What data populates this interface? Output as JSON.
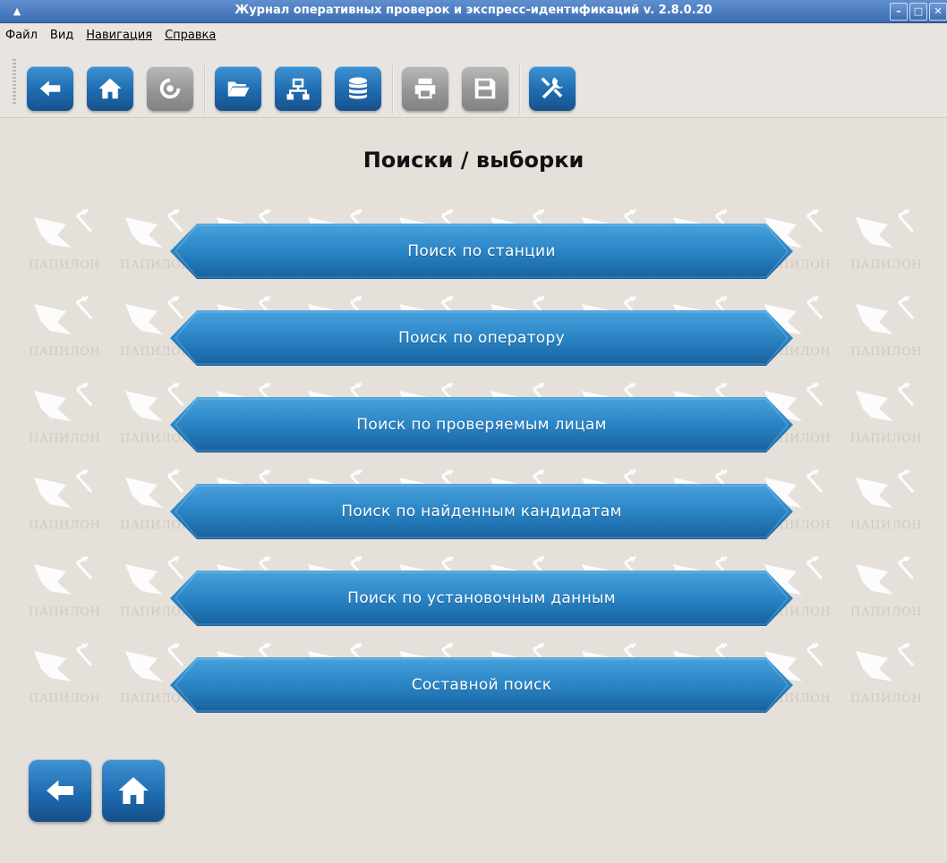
{
  "window": {
    "title": "Журнал оперативных проверок и экспресс-идентификаций v. 2.8.0.20"
  },
  "menu": [
    {
      "label": "Файл"
    },
    {
      "label": "Вид"
    },
    {
      "label": "Навигация"
    },
    {
      "label": "Справка"
    }
  ],
  "toolbar": {
    "buttons": [
      {
        "icon": "back-arrow-icon",
        "enabled": true
      },
      {
        "icon": "home-icon",
        "enabled": true
      },
      {
        "icon": "refresh-icon",
        "enabled": false
      },
      {
        "icon": "folder-open-icon",
        "enabled": true
      },
      {
        "icon": "network-icon",
        "enabled": true
      },
      {
        "icon": "database-icon",
        "enabled": true
      },
      {
        "icon": "print-icon",
        "enabled": false
      },
      {
        "icon": "save-icon",
        "enabled": false
      },
      {
        "icon": "tools-icon",
        "enabled": true
      }
    ]
  },
  "page": {
    "title": "Поиски / выборки",
    "watermark_text": "ПАПИЛОН"
  },
  "search_buttons": [
    {
      "label": "Поиск по станции"
    },
    {
      "label": "Поиск по оператору"
    },
    {
      "label": "Поиск по проверяемым лицам"
    },
    {
      "label": "Поиск по найденным кандидатам"
    },
    {
      "label": "Поиск по установочным данным"
    },
    {
      "label": "Составной поиск"
    }
  ],
  "bottom_nav": [
    {
      "icon": "back-arrow-icon"
    },
    {
      "icon": "home-icon"
    }
  ],
  "colors": {
    "accent_blue": "#1f6bb0",
    "background": "#e6e0da",
    "titlebar": "#4a7cc0",
    "disabled": "#969696"
  }
}
